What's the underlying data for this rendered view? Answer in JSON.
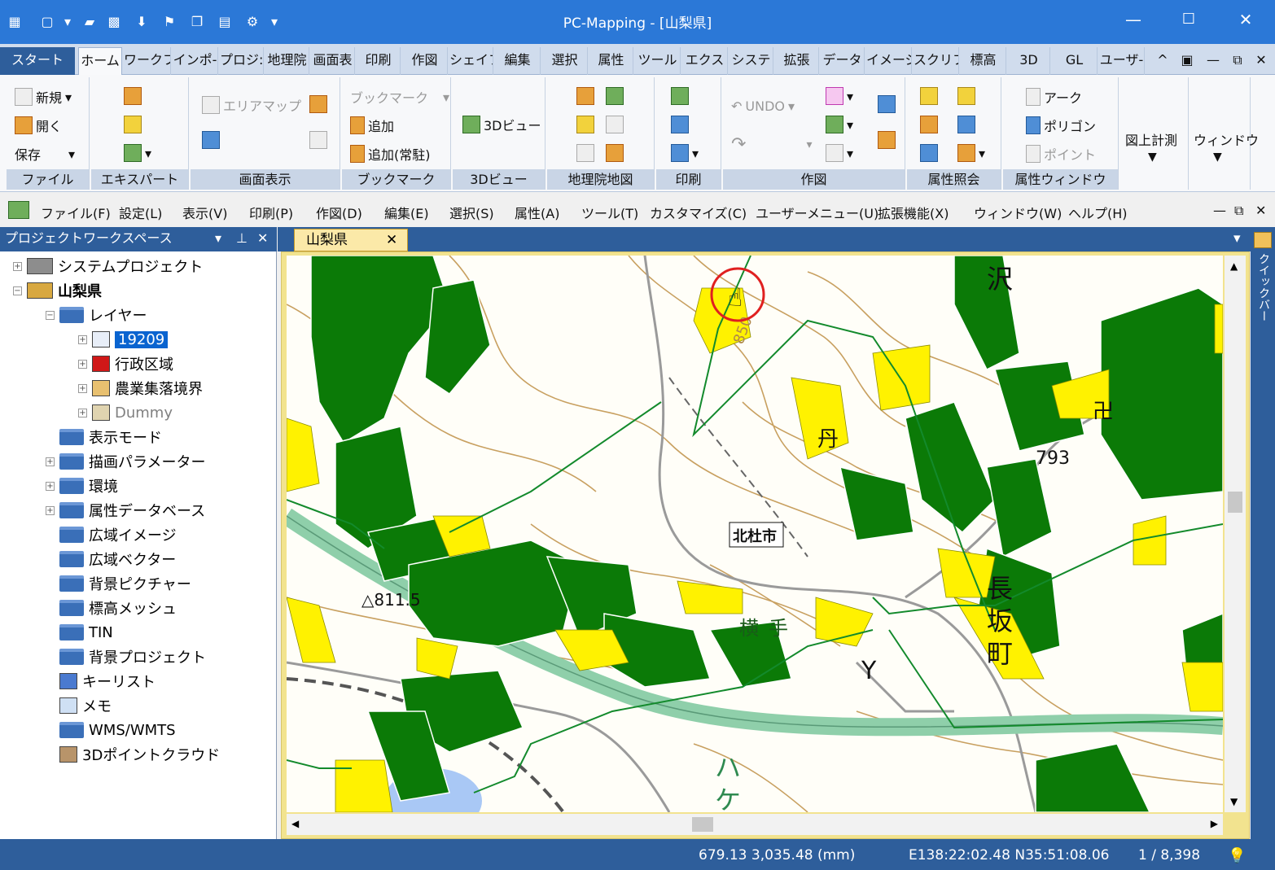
{
  "window": {
    "title": "PC-Mapping - [山梨県]",
    "minimize": "—",
    "maximize": "☐",
    "close": "✕"
  },
  "quick_access": [
    "app-icon",
    "new-icon",
    "dropdown-icon",
    "open-folder-icon",
    "excel-icon",
    "import-icon",
    "flag-icon",
    "copy-icon",
    "print-icon",
    "gear-icon",
    "dropdown-icon"
  ],
  "ribbon_tabs": [
    "スタート",
    "ホーム",
    "ワークフ",
    "インポ-",
    "プロジ:",
    "地理院",
    "画面表",
    "印刷",
    "作図",
    "シェイフ",
    "編集",
    "選択",
    "属性",
    "ツール",
    "エクス",
    "システ",
    "拡張",
    "データ",
    "イメージ",
    "スクリフ",
    "標高",
    "3D",
    "GL",
    "ユーザ-"
  ],
  "ribbon_ctrl": {
    "up": "^",
    "pin": "▣",
    "min": "—",
    "restore": "⧉",
    "close": "✕"
  },
  "groups": {
    "file": {
      "label": "ファイル",
      "new": "新規",
      "open": "開く",
      "save": "保存"
    },
    "expert": {
      "label": "エキスパート"
    },
    "screen": {
      "label": "画面表示",
      "area_map": "エリアマップ"
    },
    "bookmark": {
      "label": "ブックマーク",
      "bookmark": "ブックマーク",
      "add": "追加",
      "add_resident": "追加(常駐)"
    },
    "view3d": {
      "label": "3Dビュー",
      "btn": "3Dビュー"
    },
    "gsi": {
      "label": "地理院地図"
    },
    "print": {
      "label": "印刷"
    },
    "draw": {
      "label": "作図",
      "undo": "UNDO"
    },
    "attr": {
      "label": "属性照会"
    },
    "attrwin": {
      "label": "属性ウィンドウ",
      "arc": "アーク",
      "polygon": "ポリゴン",
      "point": "ポイント"
    },
    "measure": {
      "label": "図上計測"
    },
    "window": {
      "label": "ウィンドウ"
    }
  },
  "menu": [
    "ファイル(F)",
    "設定(L)",
    "表示(V)",
    "印刷(P)",
    "作図(D)",
    "編集(E)",
    "選択(S)",
    "属性(A)",
    "ツール(T)",
    "カスタマイズ(C)",
    "ユーザーメニュー(U)",
    "拡張機能(X)",
    "ウィンドウ(W)",
    "ヘルプ(H)"
  ],
  "workspace": {
    "title": "プロジェクトワークスペース",
    "items": [
      {
        "label": "システムプロジェクト",
        "level": 0,
        "exp": "+",
        "icon": "system-project-icon"
      },
      {
        "label": "山梨県",
        "level": 0,
        "exp": "−",
        "icon": "project-icon",
        "bold": true
      },
      {
        "label": "レイヤー",
        "level": 1,
        "exp": "−",
        "icon": "folder-open-icon"
      },
      {
        "label": "19209",
        "level": 2,
        "exp": "+",
        "icon": "image-layer-icon",
        "selected": true
      },
      {
        "label": "行政区域",
        "level": 2,
        "exp": "+",
        "icon": "polygon-layer-icon"
      },
      {
        "label": "農業集落境界",
        "level": 2,
        "exp": "+",
        "icon": "boundary-layer-icon"
      },
      {
        "label": "Dummy",
        "level": 2,
        "exp": "+",
        "icon": "dummy-layer-icon",
        "dim": true
      },
      {
        "label": "表示モード",
        "level": 1,
        "exp": "",
        "icon": "folder-icon"
      },
      {
        "label": "描画パラメーター",
        "level": 1,
        "exp": "+",
        "icon": "folder-icon"
      },
      {
        "label": "環境",
        "level": 1,
        "exp": "+",
        "icon": "folder-icon"
      },
      {
        "label": "属性データベース",
        "level": 1,
        "exp": "+",
        "icon": "folder-icon"
      },
      {
        "label": "広域イメージ",
        "level": 1,
        "exp": "",
        "icon": "folder-icon"
      },
      {
        "label": "広域ベクター",
        "level": 1,
        "exp": "",
        "icon": "folder-icon"
      },
      {
        "label": "背景ピクチャー",
        "level": 1,
        "exp": "",
        "icon": "folder-icon"
      },
      {
        "label": "標高メッシュ",
        "level": 1,
        "exp": "",
        "icon": "folder-icon"
      },
      {
        "label": "TIN",
        "level": 1,
        "exp": "",
        "icon": "folder-icon"
      },
      {
        "label": "背景プロジェクト",
        "level": 1,
        "exp": "",
        "icon": "folder-icon"
      },
      {
        "label": "キーリスト",
        "level": 1,
        "exp": "",
        "icon": "keylist-icon"
      },
      {
        "label": "メモ",
        "level": 1,
        "exp": "",
        "icon": "memo-icon"
      },
      {
        "label": "WMS/WMTS",
        "level": 1,
        "exp": "",
        "icon": "folder-icon"
      },
      {
        "label": "3Dポイントクラウド",
        "level": 1,
        "exp": "",
        "icon": "pointcloud-icon"
      }
    ]
  },
  "document": {
    "tab": "山梨県",
    "close": "✕"
  },
  "map": {
    "city_label": "北杜市",
    "labels": {
      "elev850": "850",
      "bm": "△811.5",
      "e793": "793",
      "sawa": "沢",
      "naga": "長",
      "saka": "坂",
      "machi": "町",
      "ha": "ハ",
      "ke": "ケ",
      "yoko": "横",
      "te": "手",
      "gate": "卍",
      "moon": "丹",
      "y_sym": "Y"
    },
    "colors": {
      "paddy": "#0b7a07",
      "field": "#fff200",
      "road_green": "#8fcfaa",
      "contour": "#c8a060",
      "boundary": "#138a2c",
      "water": "#a9c8f5"
    }
  },
  "side_panel": "クイックバー",
  "status": {
    "coords": "679.13 3,035.48 (mm)",
    "latlon": "E138:22:02.48 N35:51:08.06",
    "page": "1 / 8,398"
  }
}
